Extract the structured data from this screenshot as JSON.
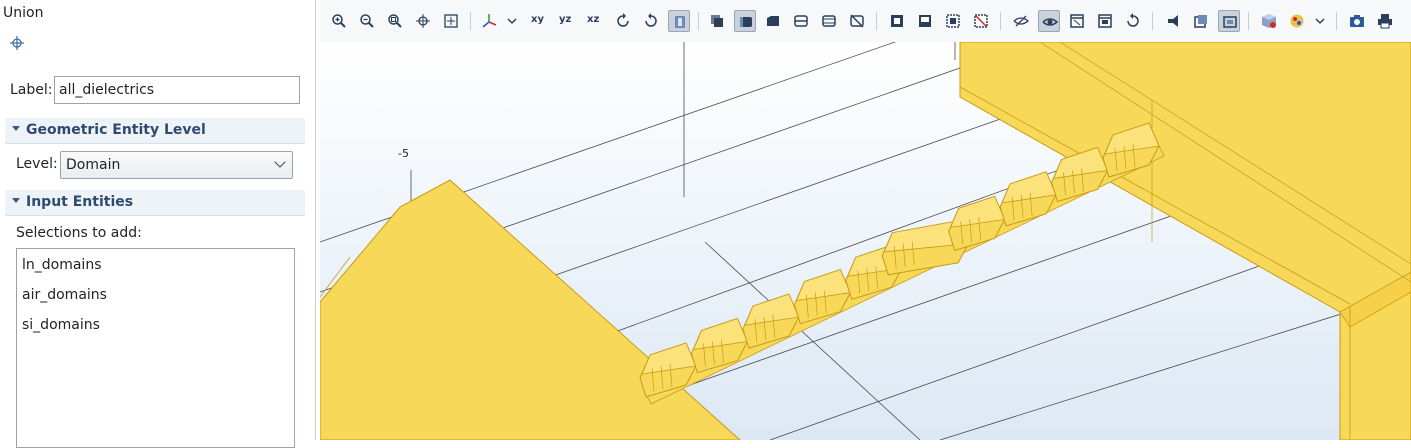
{
  "panel": {
    "title": "Union",
    "label_caption": "Label:",
    "label_value": "all_dielectrics",
    "section_geometric": "Geometric Entity Level",
    "level_caption": "Level:",
    "level_value": "Domain",
    "section_input": "Input Entities",
    "selections_caption": "Selections to add:",
    "selections": [
      "ln_domains",
      "air_domains",
      "si_domains"
    ]
  },
  "toolbar": {
    "icons": [
      "zoom-in-icon",
      "zoom-out-icon",
      "zoom-box-icon",
      "zoom-selected-icon",
      "zoom-extents-icon",
      "axis-orientation-icon",
      "xy-view",
      "yz-view",
      "xz-view",
      "rotate-cw-icon",
      "rotate-ccw-icon",
      "view-mode-icon",
      "transparency-icon",
      "render-wireframe-icon",
      "select-domain-icon",
      "select-boundary-icon",
      "select-edge-icon",
      "select-point-icon",
      "select-box-icon",
      "deselect-box-icon",
      "select-all-icon",
      "clear-selection-icon",
      "hide-icon",
      "show-icon",
      "hide-selected-icon",
      "show-selected-icon",
      "reset-hiding-icon",
      "light-icon",
      "scene-icon",
      "render-icon",
      "cube-icon",
      "materials-icon",
      "screenshot-icon",
      "print-icon"
    ],
    "xy_label": "xy",
    "yz_label": "yz",
    "xz_label": "xz"
  },
  "viewport": {
    "axis_tick": "-5",
    "colors": {
      "geometry": "#f8d858",
      "edge": "#c99a12",
      "grid": "#4a4a4a"
    }
  }
}
